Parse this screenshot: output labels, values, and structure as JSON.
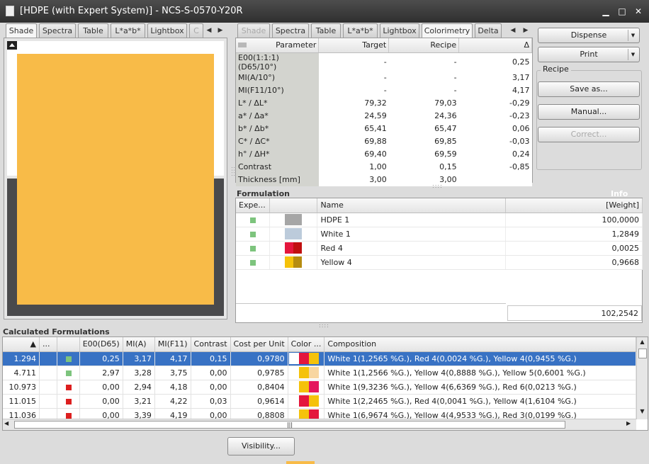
{
  "window": {
    "title": "[HDPE (with Expert System)] - NCS-S-0570-Y20R",
    "minimize": "▁",
    "maximize": "□",
    "close": "✕"
  },
  "left_tabs": [
    "Shade",
    "Spectra",
    "Table",
    "L*a*b*",
    "Lightbox"
  ],
  "left_tab_partial": "C",
  "shade": {
    "color": "#f8bb48"
  },
  "right_tabs": [
    "Shade",
    "Spectra",
    "Table",
    "L*a*b*",
    "Lightbox",
    "Colorimetry",
    "Delta"
  ],
  "colorimetry": {
    "headers": [
      "Parameter",
      "Target",
      "Recipe",
      "Δ"
    ],
    "rows": [
      [
        "E00(1:1:1)(D65/10°)",
        "-",
        "-",
        "0,25"
      ],
      [
        "MI(A/10°)",
        "-",
        "-",
        "3,17"
      ],
      [
        "MI(F11/10°)",
        "-",
        "-",
        "4,17"
      ],
      [
        "L* / ΔL*",
        "79,32",
        "79,03",
        "-0,29"
      ],
      [
        "a* / Δa*",
        "24,59",
        "24,36",
        "-0,23"
      ],
      [
        "b* / Δb*",
        "65,41",
        "65,47",
        "0,06"
      ],
      [
        "C* / ΔC*",
        "69,88",
        "69,85",
        "-0,03"
      ],
      [
        "h° / ΔH*",
        "69,40",
        "69,59",
        "0,24"
      ],
      [
        "Contrast",
        "1,00",
        "0,15",
        "-0,85"
      ],
      [
        "Thickness [mm]",
        "3,00",
        "3,00",
        ""
      ]
    ]
  },
  "buttons": {
    "dispense": "Dispense",
    "print": "Print",
    "recipe_group": "Recipe",
    "save_as": "Save as...",
    "manual": "Manual...",
    "correct": "Correct...",
    "visibility": "Visibility..."
  },
  "formulation": {
    "title": "Formulation",
    "info": "Info",
    "headers": [
      "Expe...",
      "",
      "Name",
      "[Weight]"
    ],
    "rows": [
      {
        "name": "HDPE 1",
        "weight": "100,0000",
        "c1": "#a6a6a6",
        "c2": "#a6a6a6"
      },
      {
        "name": "White 1",
        "weight": "1,2849",
        "c1": "#bccbdb",
        "c2": "#bccbdb"
      },
      {
        "name": "Red 4",
        "weight": "0,0025",
        "c1": "#e4163c",
        "c2": "#c00f0f"
      },
      {
        "name": "Yellow 4",
        "weight": "0,9668",
        "c1": "#f5c20a",
        "c2": "#b68c10"
      }
    ],
    "total": "102,2542"
  },
  "calculated": {
    "title": "Calculated Formulations",
    "headers": [
      "▲",
      "...",
      "",
      "E00(D65)",
      "MI(A)",
      "MI(F11)",
      "Contrast",
      "Cost per Unit",
      "Color ...",
      "Composition"
    ],
    "rows": [
      {
        "id": "1.294",
        "flag": "green",
        "e00": "0,25",
        "mia": "3,17",
        "mif": "4,17",
        "contrast": "0,15",
        "cost": "0,9780",
        "sw": [
          "#ffffff",
          "#e4163c",
          "#f5c20a"
        ],
        "comp": "White 1(1,2565 %G.), Red 4(0,0024 %G.), Yellow 4(0,9455 %G.)"
      },
      {
        "id": "4.711",
        "flag": "green",
        "e00": "2,97",
        "mia": "3,28",
        "mif": "3,75",
        "contrast": "0,00",
        "cost": "0,9785",
        "sw": [
          "#ffffff",
          "#f5c20a",
          "#f8d6a0"
        ],
        "comp": "White 1(1,2566 %G.), Yellow 4(0,8888 %G.), Yellow 5(0,6001 %G.)"
      },
      {
        "id": "10.973",
        "flag": "red",
        "e00": "0,00",
        "mia": "2,94",
        "mif": "4,18",
        "contrast": "0,00",
        "cost": "0,8404",
        "sw": [
          "#ffffff",
          "#f5c20a",
          "#e4165c"
        ],
        "comp": "White 1(9,3236 %G.), Yellow 4(6,6369 %G.), Red 6(0,0213 %G.)"
      },
      {
        "id": "11.015",
        "flag": "red",
        "e00": "0,00",
        "mia": "3,21",
        "mif": "4,22",
        "contrast": "0,03",
        "cost": "0,9614",
        "sw": [
          "#ffffff",
          "#e4163c",
          "#f5c20a"
        ],
        "comp": "White 1(2,2465 %G.), Red 4(0,0041 %G.), Yellow 4(1,6104 %G.)"
      },
      {
        "id": "11.036",
        "flag": "red",
        "e00": "0,00",
        "mia": "3,39",
        "mif": "4,19",
        "contrast": "0,00",
        "cost": "0,8808",
        "sw": [
          "#ffffff",
          "#f5c20a",
          "#e4163c"
        ],
        "comp": "White 1(6,9674 %G.), Yellow 4(4,9533 %G.), Red 3(0,0199 %G.)"
      }
    ]
  }
}
